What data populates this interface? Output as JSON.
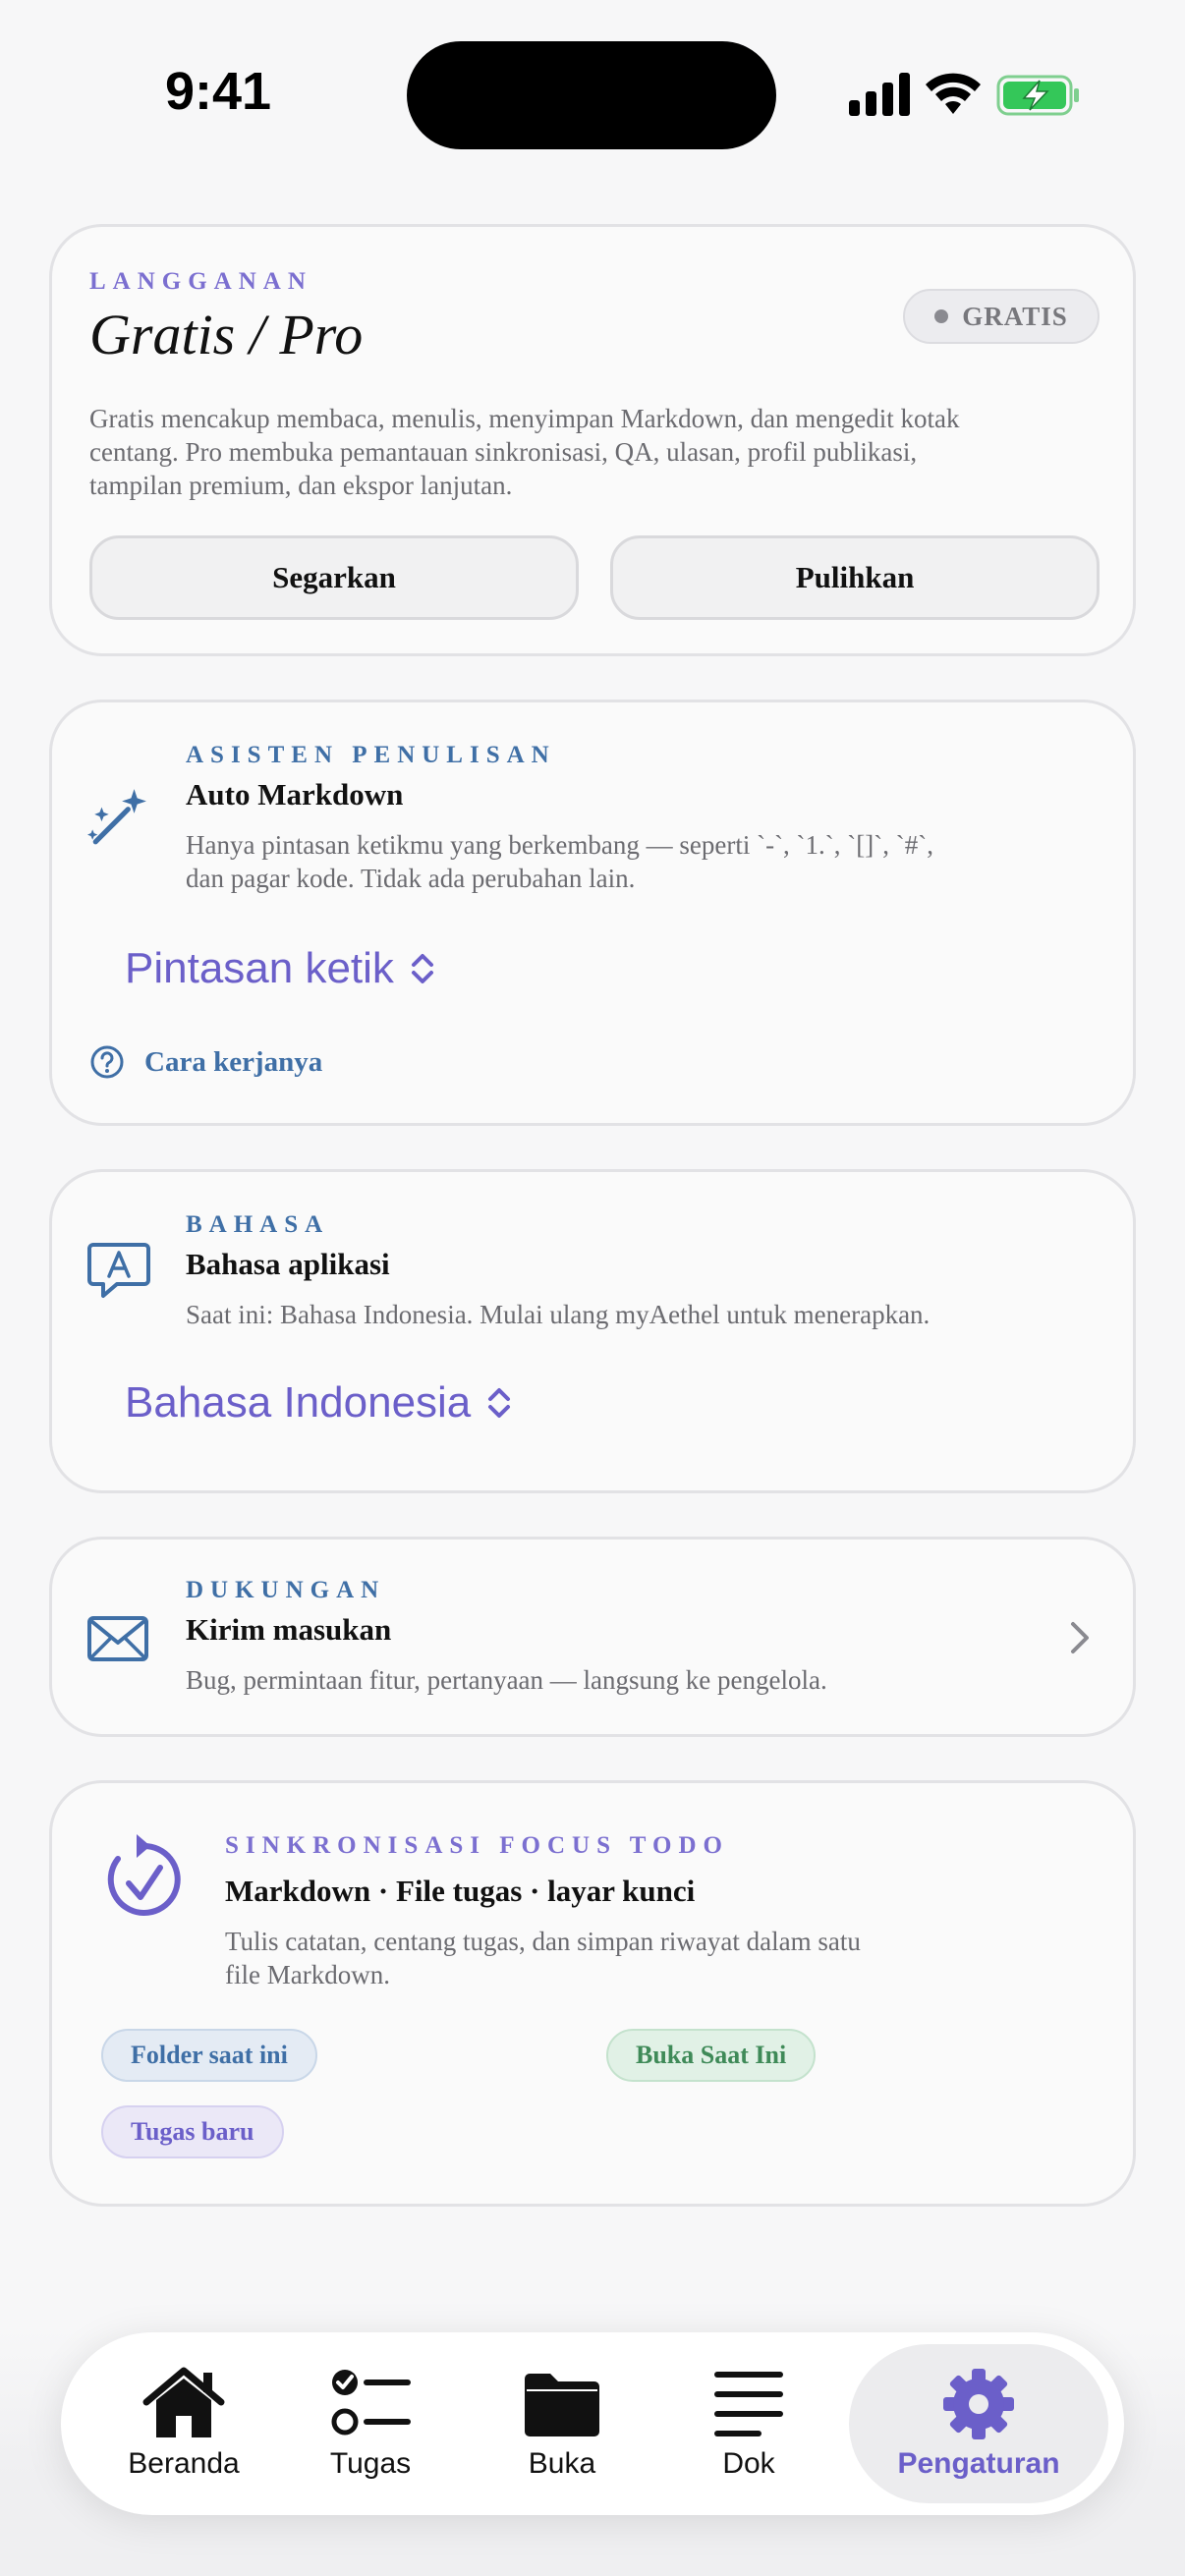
{
  "status": {
    "time": "9:41"
  },
  "subscription": {
    "eyebrow": "LANGGANAN",
    "title": "Gratis / Pro",
    "badge": "GRATIS",
    "description_lines": [
      "Gratis mencakup membaca, menulis, menyimpan Markdown, dan mengedit kotak",
      "centang. Pro membuka pemantauan sinkronisasi, QA, ulasan, profil publikasi,",
      "tampilan premium, dan ekspor lanjutan."
    ],
    "refresh_label": "Segarkan",
    "restore_label": "Pulihkan"
  },
  "assistant": {
    "eyebrow": "ASISTEN PENULISAN",
    "heading": "Auto Markdown",
    "description_lines": [
      "Hanya pintasan ketikmu yang berkembang — seperti `-`, `1.`, `[]`, `#`,",
      "dan pagar kode. Tidak ada perubahan lain."
    ],
    "picker_value": "Pintasan ketik",
    "help_link": "Cara kerjanya",
    "icon": "magic-wand-icon"
  },
  "language": {
    "eyebrow": "BAHASA",
    "heading": "Bahasa aplikasi",
    "description": "Saat ini: Bahasa Indonesia. Mulai ulang myAethel untuk menerapkan.",
    "picker_value": "Bahasa Indonesia",
    "icon": "language-bubble-icon"
  },
  "support": {
    "eyebrow": "DUKUNGAN",
    "heading": "Kirim masukan",
    "description": "Bug, permintaan fitur, pertanyaan — langsung ke pengelola.",
    "icon": "envelope-icon"
  },
  "sync": {
    "eyebrow": "SINKRONISASI FOCUS TODO",
    "heading": "Markdown · File tugas · layar kunci",
    "description_lines": [
      "Tulis catatan, centang tugas, dan simpan riwayat dalam satu",
      "file Markdown."
    ],
    "chips": {
      "current_folder": "Folder saat ini",
      "open_now": "Buka Saat Ini",
      "new_task": "Tugas baru"
    },
    "icon": "sync-check-icon"
  },
  "tabs": [
    {
      "label": "Beranda",
      "icon": "home-icon"
    },
    {
      "label": "Tugas",
      "icon": "checklist-icon"
    },
    {
      "label": "Buka",
      "icon": "folder-icon"
    },
    {
      "label": "Dok",
      "icon": "document-lines-icon"
    },
    {
      "label": "Pengaturan",
      "icon": "gear-icon",
      "active": true
    }
  ],
  "colors": {
    "accent": "#6b5fc9",
    "blue": "#3f6fa6",
    "green": "#3f8a58"
  }
}
